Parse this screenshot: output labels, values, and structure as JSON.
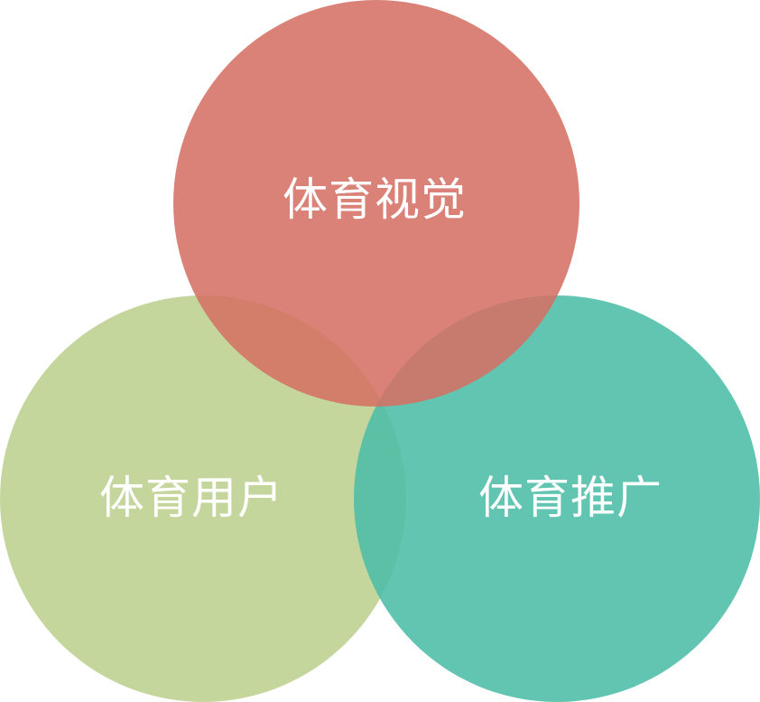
{
  "diagram": {
    "type": "venn",
    "circles": [
      {
        "id": "top",
        "label": "体育视觉",
        "color": "#d57164",
        "opacity": 0.88
      },
      {
        "id": "left",
        "label": "体育用户",
        "color": "#bdd08e",
        "opacity": 0.88
      },
      {
        "id": "right",
        "label": "体育推广",
        "color": "#4cbda7",
        "opacity": 0.88
      }
    ]
  }
}
